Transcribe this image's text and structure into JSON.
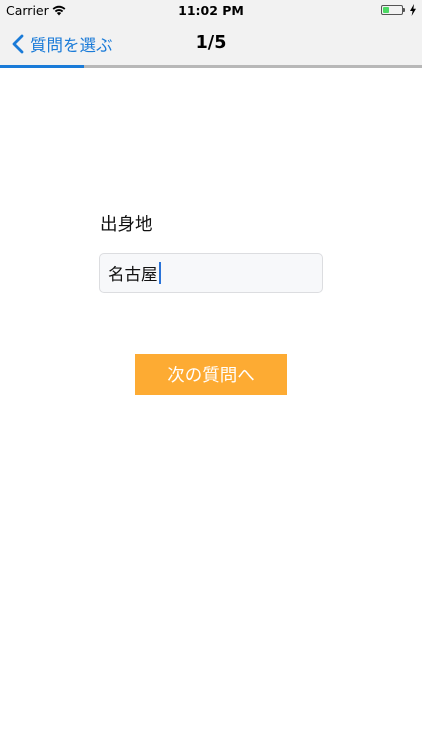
{
  "status_bar": {
    "carrier": "Carrier",
    "time": "11:02 PM",
    "battery_level": 0.4,
    "battery_color": "#4cd964"
  },
  "nav": {
    "back_label": "質問を選ぶ",
    "title": "1/5",
    "accent_color": "#1a7bd8",
    "progress": 0.2
  },
  "form": {
    "question_label": "出身地",
    "answer_value": "名古屋",
    "next_button_label": "次の質問へ",
    "button_color": "#fdab33"
  }
}
